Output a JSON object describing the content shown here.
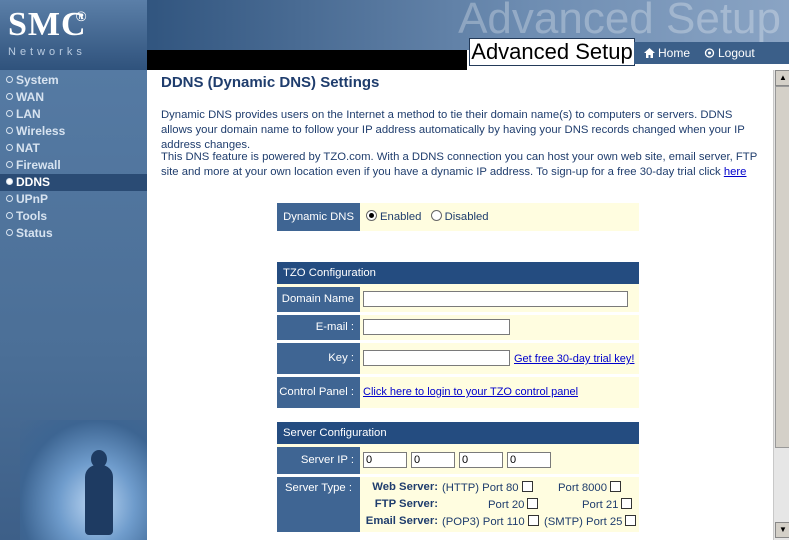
{
  "header": {
    "logo": "SMC",
    "logo_reg": "®",
    "logo_sub": "Networks",
    "banner_ghost": "Advanced Setup",
    "title": "Advanced Setup",
    "home": "Home",
    "logout": "Logout"
  },
  "sidebar": {
    "items": [
      {
        "label": "System"
      },
      {
        "label": "WAN"
      },
      {
        "label": "LAN"
      },
      {
        "label": "Wireless"
      },
      {
        "label": "NAT"
      },
      {
        "label": "Firewall"
      },
      {
        "label": "DDNS",
        "active": true
      },
      {
        "label": "UPnP"
      },
      {
        "label": "Tools"
      },
      {
        "label": "Status"
      }
    ]
  },
  "main": {
    "title": "DDNS (Dynamic DNS) Settings",
    "para1": "Dynamic DNS provides users on the Internet a method to tie their domain name(s) to computers or servers. DDNS allows your domain name to follow your IP address automatically by having your DNS records changed when your IP address changes.",
    "para2": "This DNS feature is powered by TZO.com. With a DDNS connection you can host your own web site, email server, FTP site and more at your own location even if you have a dynamic IP address. To sign-up for a free 30-day trial click",
    "para2_link": "here",
    "ddns": {
      "label": "Dynamic DNS :",
      "enabled": "Enabled",
      "disabled": "Disabled",
      "selected": "Enabled"
    },
    "tzo": {
      "header": "TZO Configuration",
      "domain_label": "Domain Name :",
      "domain_value": "",
      "email_label": "E-mail :",
      "email_value": "",
      "key_label": "Key :",
      "key_value": "",
      "key_link": "Get free 30-day trial key!",
      "cp_label": "Control Panel :",
      "cp_link": "Click here to login to your TZO control panel"
    },
    "server": {
      "header": "Server Configuration",
      "ip_label": "Server IP :",
      "ip": [
        "0",
        "0",
        "0",
        "0"
      ],
      "type_label": "Server Type :",
      "web_name": "Web Server:",
      "web_p1": "(HTTP) Port 80",
      "web_p2": "Port 8000",
      "ftp_name": "FTP Server:",
      "ftp_p1": "Port 20",
      "ftp_p2": "Port 21",
      "mail_name": "Email Server:",
      "mail_p1": "(POP3) Port 110",
      "mail_p2": "(SMTP) Port 25"
    }
  }
}
